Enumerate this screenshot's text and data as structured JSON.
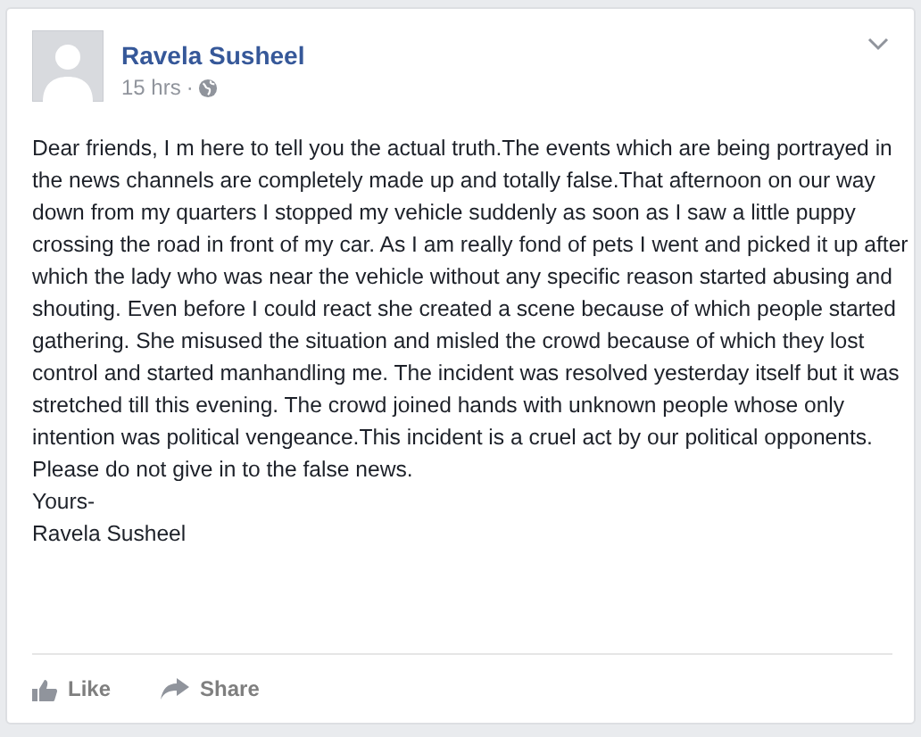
{
  "post": {
    "author": "Ravela Susheel",
    "time": "15 hrs",
    "separator": "·",
    "body": [
      "Dear friends, I m here to tell you the actual truth.The events which are being portrayed in the news channels are completely made up and totally false.That afternoon on our way down from my quarters I stopped my vehicle suddenly as soon as I saw a little puppy crossing the road in front of my car. As I am really fond of pets I went and picked it up after which the lady who was near the vehicle without any specific reason started abusing and shouting. Even before I could react she created a scene because of which people started gathering. She misused the situation and misled the crowd because of which they lost control and started manhandling me. The incident was resolved yesterday itself but it was stretched till this evening. The crowd joined hands with unknown people whose only intention was political vengeance.This incident is a cruel act by our political opponents. Please do not give in to the false news.",
      "Yours-",
      "Ravela Susheel"
    ],
    "actions": [
      {
        "kind": "like",
        "label": "Like"
      },
      {
        "kind": "share",
        "label": "Share"
      }
    ]
  }
}
